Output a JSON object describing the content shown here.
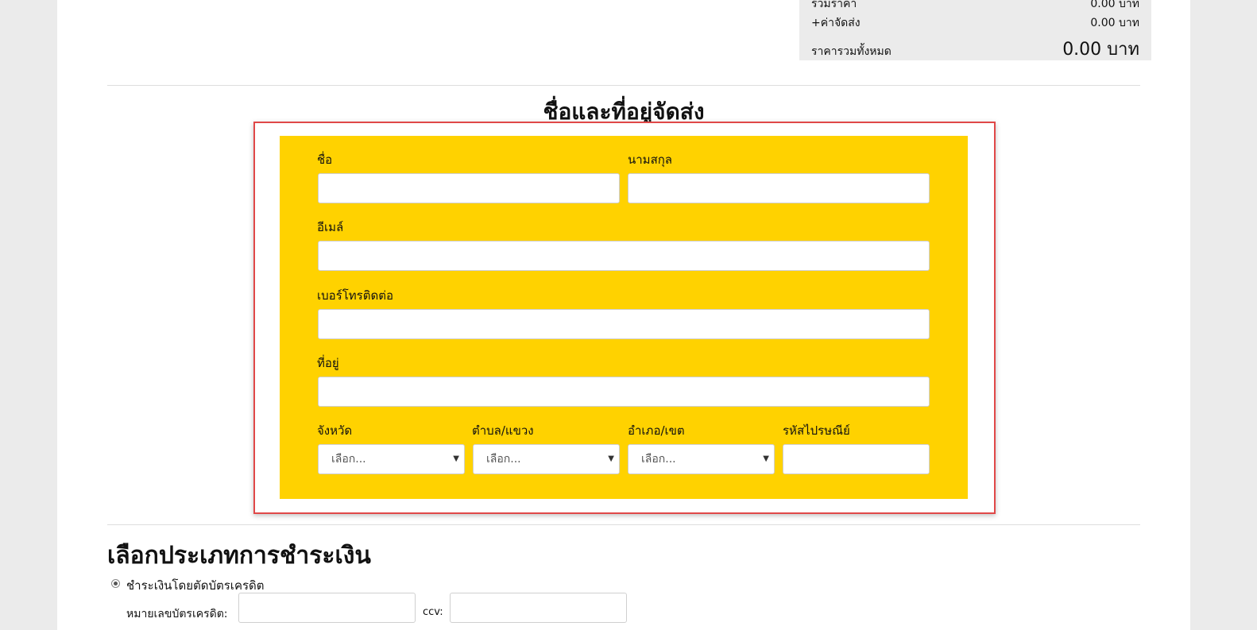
{
  "summary": {
    "subtotal_label": "รวมราคา",
    "subtotal_value": "0.00 บาท",
    "shipping_label": "+ค่าจัดส่ง",
    "shipping_value": "0.00 บาท",
    "total_label": "ราคารวมทั้งหมด",
    "total_value": "0.00 บาท"
  },
  "shipping": {
    "title": "ชื่อและที่อยู่จัดส่ง",
    "first_name_label": "ชื่อ",
    "first_name_value": "",
    "last_name_label": "นามสกุล",
    "last_name_value": "",
    "email_label": "อีเมล์",
    "email_value": "",
    "phone_label": "เบอร์โทรติดต่อ",
    "phone_value": "",
    "address_label": "ที่อยู่",
    "address_value": "",
    "province_label": "จังหวัด",
    "province_selected": "เลือก...",
    "subdistrict_label": "ตำบล/แขวง",
    "subdistrict_selected": "เลือก...",
    "district_label": "อำเภอ/เขต",
    "district_selected": "เลือก...",
    "postcode_label": "รหัสไปรษณีย์",
    "postcode_value": ""
  },
  "payment": {
    "title": "เลือกประเภทการชำระเงิน",
    "option_credit_label": "ชำระเงินโดยตัดบัตรเครดิต",
    "card_number_label": "หมายเลขบัตรเครดิต:",
    "card_number_value": "",
    "ccv_label": "ccv:",
    "ccv_value": ""
  },
  "icons": {
    "select_arrow": "chevron-down-icon"
  },
  "colors": {
    "form_background": "#ffd200",
    "highlight_border": "#e04848",
    "page_gutter": "#ebebeb"
  }
}
